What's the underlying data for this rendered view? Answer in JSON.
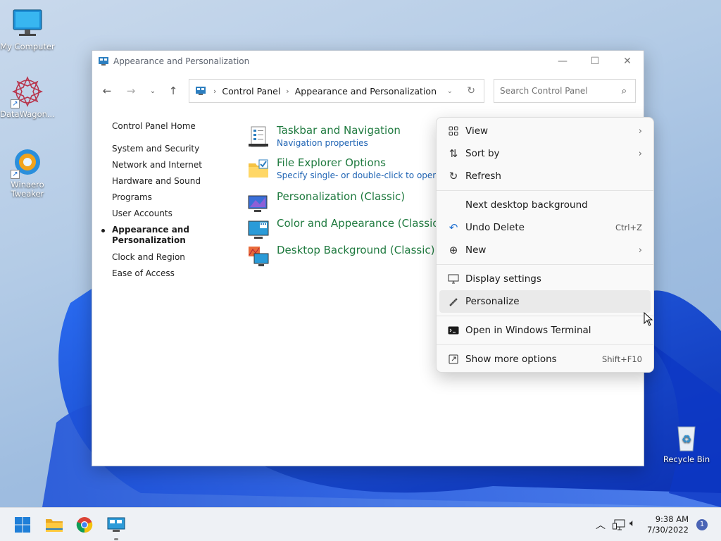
{
  "desktop": {
    "icons": [
      {
        "label": "My Computer",
        "icon": "monitor-icon"
      },
      {
        "label": "DataWagon...",
        "icon": "datawagon-icon"
      },
      {
        "label": "Winaero Tweaker",
        "icon": "winaero-icon"
      },
      {
        "label": "Recycle Bin",
        "icon": "recycle-bin-icon"
      }
    ]
  },
  "window": {
    "title": "Appearance and Personalization",
    "address": {
      "segments": [
        "Control Panel",
        "Appearance and Personalization"
      ]
    },
    "search_placeholder": "Search Control Panel",
    "sidebar": {
      "home": "Control Panel Home",
      "items": [
        {
          "label": "System and Security"
        },
        {
          "label": "Network and Internet"
        },
        {
          "label": "Hardware and Sound"
        },
        {
          "label": "Programs"
        },
        {
          "label": "User Accounts"
        },
        {
          "label": "Appearance and Personalization",
          "active": true
        },
        {
          "label": "Clock and Region"
        },
        {
          "label": "Ease of Access"
        }
      ]
    },
    "tasks": [
      {
        "title": "Taskbar and Navigation",
        "sub": "Navigation properties",
        "icon": "taskbar-icon"
      },
      {
        "title": "File Explorer Options",
        "sub": "Specify single- or double-click to open",
        "icon": "folder-options-icon"
      },
      {
        "title": "Personalization (Classic)",
        "sub": "",
        "icon": "personalization-icon"
      },
      {
        "title": "Color and Appearance (Classic)",
        "sub": "",
        "icon": "color-icon"
      },
      {
        "title": "Desktop Background (Classic)",
        "sub": "",
        "icon": "desktop-background-icon"
      }
    ]
  },
  "context_menu": {
    "items": [
      {
        "label": "View",
        "icon": "grid-icon",
        "submenu": true
      },
      {
        "label": "Sort by",
        "icon": "sort-icon",
        "submenu": true
      },
      {
        "label": "Refresh",
        "icon": "refresh-icon"
      },
      {
        "label": "Next desktop background",
        "icon": ""
      },
      {
        "label": "Undo Delete",
        "icon": "undo-icon",
        "shortcut": "Ctrl+Z"
      },
      {
        "label": "New",
        "icon": "plus-circle-icon",
        "submenu": true
      },
      {
        "label": "Display settings",
        "icon": "display-icon"
      },
      {
        "label": "Personalize",
        "icon": "brush-icon",
        "highlighted": true
      },
      {
        "label": "Open in Windows Terminal",
        "icon": "terminal-icon"
      },
      {
        "label": "Show more options",
        "icon": "more-options-icon",
        "shortcut": "Shift+F10"
      }
    ]
  },
  "taskbar": {
    "time": "9:38 AM",
    "date": "7/30/2022",
    "notifications": "1"
  }
}
